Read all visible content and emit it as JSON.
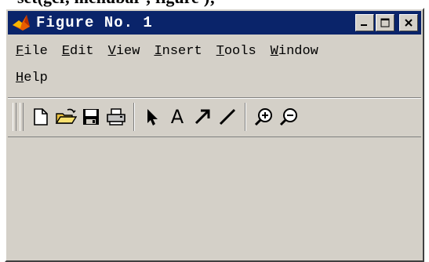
{
  "code_snippet": "set(gcf,'menubar','figure');",
  "window": {
    "title": "Figure No. 1",
    "icon": "matlab-logo-icon",
    "buttons": [
      "minimize-icon",
      "maximize-icon",
      "close-icon"
    ]
  },
  "menu": {
    "row1": [
      {
        "hot": "F",
        "rest": "ile"
      },
      {
        "hot": "E",
        "rest": "dit"
      },
      {
        "hot": "V",
        "rest": "iew"
      },
      {
        "hot": "I",
        "rest": "nsert"
      },
      {
        "hot": "T",
        "rest": "ools"
      },
      {
        "hot": "W",
        "rest": "indow"
      }
    ],
    "row2": [
      {
        "hot": "H",
        "rest": "elp"
      }
    ]
  },
  "toolbar": {
    "icons": [
      "new-file-icon",
      "open-folder-icon",
      "save-disk-icon",
      "print-icon",
      "select-arrow-icon",
      "insert-text-icon",
      "insert-arrow-icon",
      "insert-line-icon",
      "zoom-in-icon",
      "zoom-out-icon"
    ],
    "text_tool_glyph": "A"
  },
  "colors": {
    "titlebar": "#0a246a",
    "face": "#d4d0c8"
  }
}
